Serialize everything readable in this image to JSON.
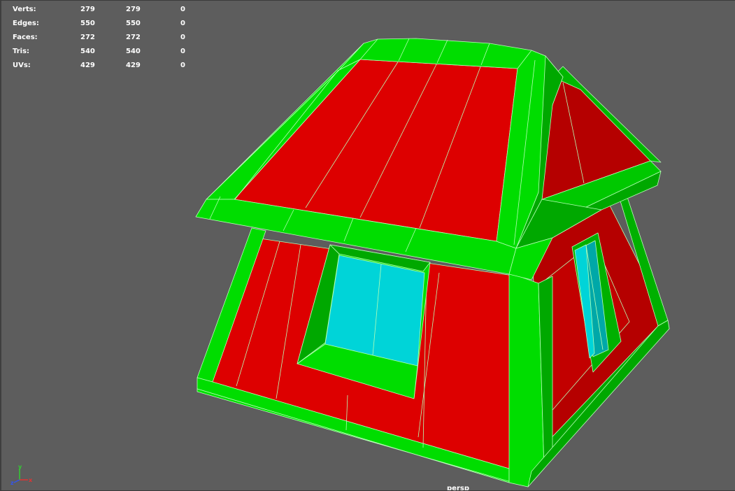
{
  "hud": {
    "rows": [
      {
        "label": "Verts:",
        "v1": "279",
        "v2": "279",
        "v3": "0"
      },
      {
        "label": "Edges:",
        "v1": "550",
        "v2": "550",
        "v3": "0"
      },
      {
        "label": "Faces:",
        "v1": "272",
        "v2": "272",
        "v3": "0"
      },
      {
        "label": "Tris:",
        "v1": "540",
        "v2": "540",
        "v3": "0"
      },
      {
        "label": "UVs:",
        "v1": "429",
        "v2": "429",
        "v3": "0"
      }
    ]
  },
  "camera": "persp",
  "axis": {
    "x": "x",
    "y": "y",
    "z": "z"
  },
  "colors": {
    "background": "#5d5d5d",
    "wall_red": "#dd0000",
    "wall_red_shade": "#b50000",
    "trim_green": "#00dd00",
    "trim_green_shade": "#00a800",
    "wire": "#b6ffb6",
    "glass": "#00d4d8",
    "axis_x": "#e33333",
    "axis_y": "#33cc33",
    "axis_z": "#3355ee"
  }
}
